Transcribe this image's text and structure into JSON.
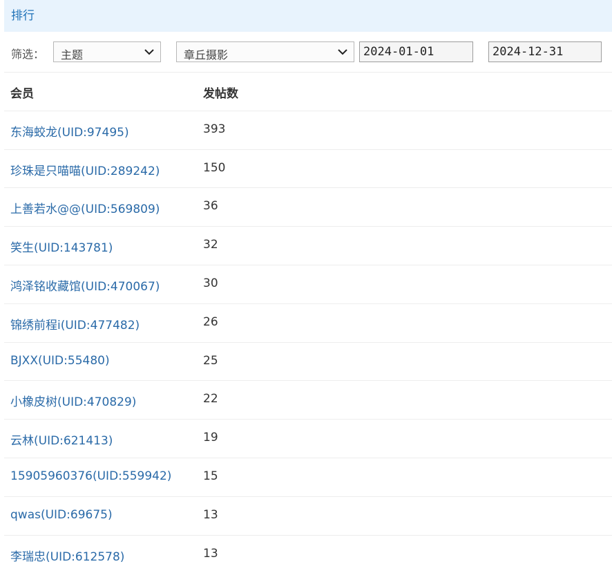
{
  "header": {
    "title": "排行"
  },
  "filter": {
    "label": "筛选：",
    "type_select": "主题",
    "forum_select": "章丘摄影",
    "start_date": "2024-01-01",
    "end_date": "2024-12-31"
  },
  "table": {
    "columns": [
      "会员",
      "发帖数"
    ],
    "rows": [
      {
        "member": "东海蛟龙(UID:97495)",
        "posts": "393"
      },
      {
        "member": "珍珠是只喵喵(UID:289242)",
        "posts": "150"
      },
      {
        "member": "上善若水@@(UID:569809)",
        "posts": "36"
      },
      {
        "member": "笑生(UID:143781)",
        "posts": "32"
      },
      {
        "member": "鸿泽铭收藏馆(UID:470067)",
        "posts": "30"
      },
      {
        "member": "锦绣前程i(UID:477482)",
        "posts": "26"
      },
      {
        "member": "BJXX(UID:55480)",
        "posts": "25"
      },
      {
        "member": "小橡皮树(UID:470829)",
        "posts": "22"
      },
      {
        "member": "云林(UID:621413)",
        "posts": "19"
      },
      {
        "member": "15905960376(UID:559942)",
        "posts": "15"
      },
      {
        "member": "qwas(UID:69675)",
        "posts": "13"
      },
      {
        "member": "李瑞忠(UID:612578)",
        "posts": "13"
      }
    ]
  }
}
